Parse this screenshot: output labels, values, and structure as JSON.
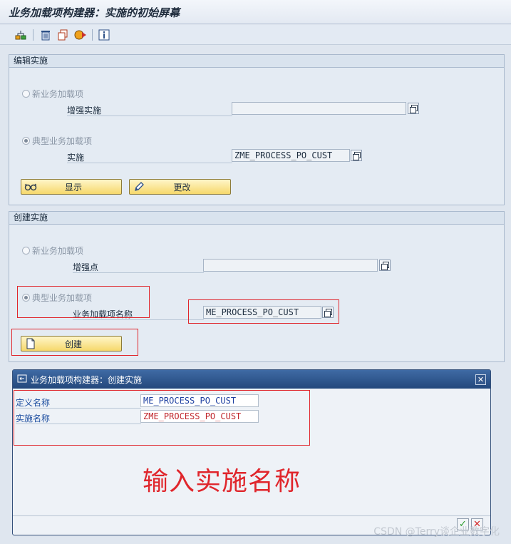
{
  "window": {
    "title": "业务加载项构建器：实施的初始屏幕"
  },
  "toolbar": {
    "icons": [
      "hierarchy-icon",
      "delete-icon",
      "copy-icon",
      "activate-icon",
      "info-icon"
    ]
  },
  "edit_group": {
    "header": "编辑实施",
    "radio_new": "新业务加载项",
    "enh_impl_label": "增强实施",
    "enh_impl_value": "",
    "radio_classic": "典型业务加载项",
    "impl_label": "实施",
    "impl_value": "ZME_PROCESS_PO_CUST",
    "display_button": "显示",
    "change_button": "更改"
  },
  "create_group": {
    "header": "创建实施",
    "radio_new": "新业务加载项",
    "enh_spot_label": "增强点",
    "enh_spot_value": "",
    "radio_classic": "典型业务加载项",
    "badi_name_label": "业务加载项名称",
    "badi_name_value": "ME_PROCESS_PO_CUST",
    "create_button": "创建"
  },
  "dialog": {
    "title": "业务加载项构建器：创建实施",
    "def_name_label": "定义名称",
    "def_name_value": "ME_PROCESS_PO_CUST",
    "impl_name_label": "实施名称",
    "impl_name_value": "ZME_PROCESS_PO_CUST"
  },
  "annotation": "输入实施名称",
  "watermark": "CSDN @Terry谈企业数字化",
  "colors": {
    "highlight": "#e0262c",
    "button": "#f6d86b",
    "dialog_title": "#2d5590"
  }
}
